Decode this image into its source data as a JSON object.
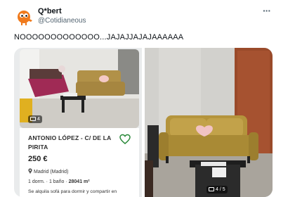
{
  "tweet": {
    "display_name": "Q*bert",
    "handle": "@Cotidianeous",
    "text": "NOOOOOOOOOOOOO...JAJAJJAJAJAAAAAA",
    "more_icon": "more-dots-icon"
  },
  "listing": {
    "title": "ANTONIO LÓPEZ - C/ DE LA PIRITA",
    "price": "250 €",
    "location": "Madrid (Madrid)",
    "bedrooms": "1 dorm.",
    "bathrooms": "1 baño",
    "area": "28041 m²",
    "description": "Se alquila sofá para dormir y compartir en"
  },
  "media": {
    "left_photo_count": "4",
    "right_photo_counter": "4 / 5"
  }
}
